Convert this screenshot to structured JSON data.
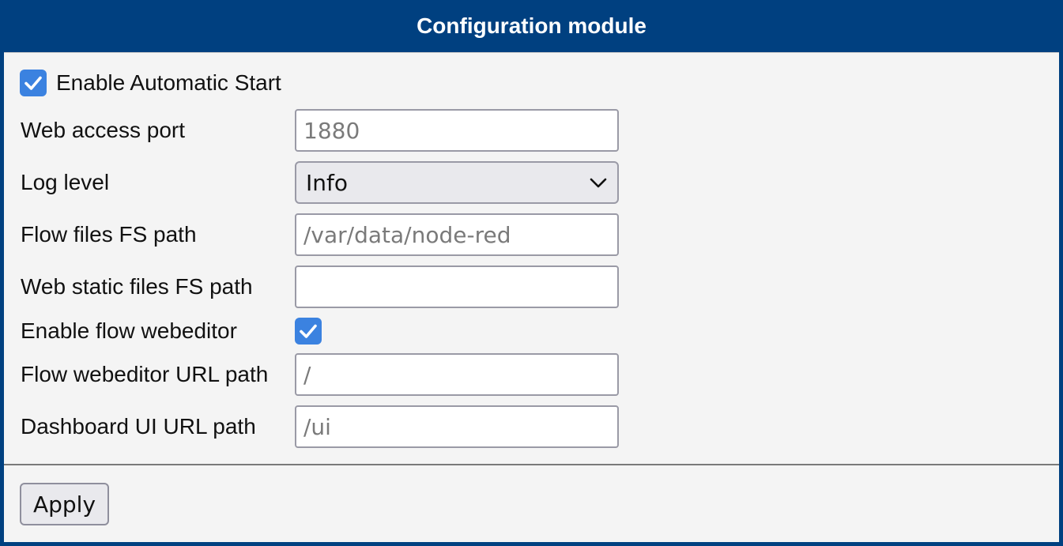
{
  "window": {
    "title": "Configuration module"
  },
  "form": {
    "auto_start": {
      "label": "Enable Automatic Start",
      "checked": true
    },
    "web_port": {
      "label": "Web access port",
      "value": "",
      "placeholder": "1880"
    },
    "log_level": {
      "label": "Log level",
      "selected": "Info"
    },
    "flow_path": {
      "label": "Flow files FS path",
      "value": "",
      "placeholder": "/var/data/node-red"
    },
    "static_path": {
      "label": "Web static files FS path",
      "value": "",
      "placeholder": ""
    },
    "flow_editor": {
      "label": "Enable flow webeditor",
      "checked": true
    },
    "editor_url": {
      "label": "Flow webeditor URL path",
      "value": "",
      "placeholder": "/"
    },
    "dashboard_url": {
      "label": "Dashboard UI URL path",
      "value": "",
      "placeholder": "/ui"
    }
  },
  "footer": {
    "apply_label": "Apply"
  },
  "icons": {
    "checkbox": "checkmark-icon",
    "select": "chevron-down-icon"
  },
  "colors": {
    "header_bg": "#004080",
    "checkbox_accent": "#3b82e0",
    "panel_bg": "#f4f4f4"
  }
}
